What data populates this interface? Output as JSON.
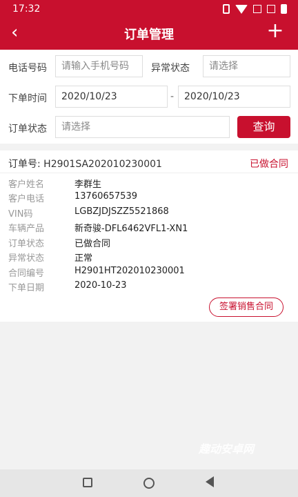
{
  "status_bar": {
    "time": "17:32"
  },
  "header": {
    "title": "订单管理",
    "back_icon": "‹",
    "add_icon": "+"
  },
  "filter": {
    "phone_label": "电话号码",
    "phone_placeholder": "请输入手机号码",
    "abnormal_label": "异常状态",
    "abnormal_placeholder": "请选择",
    "date_label": "下单时间",
    "date_from": "2020/10/23",
    "date_sep": "-",
    "date_to": "2020/10/23",
    "order_status_label": "订单状态",
    "order_status_placeholder": "请选择",
    "query_button": "查询"
  },
  "order": {
    "number_label": "订单号:",
    "number": "H2901SA202010230001",
    "status": "已做合同",
    "fields": [
      {
        "key": "客户姓名",
        "value": "李群生"
      },
      {
        "key": "客户电话",
        "value": "13760657539"
      },
      {
        "key": "VIN码",
        "value": "LGBZJDJSZZ5521868"
      },
      {
        "key": "车辆产品",
        "value": "新奇骏-DFL6462VFL1-XN1"
      },
      {
        "key": "订单状态",
        "value": "已做合同"
      },
      {
        "key": "异常状态",
        "value": "正常"
      },
      {
        "key": "合同编号",
        "value": "H2901HT202010230001"
      },
      {
        "key": "下单日期",
        "value": "2020-10-23"
      }
    ],
    "sign_button": "签署销售合同"
  },
  "watermark": "趣动安卓网",
  "colors": {
    "brand": "#c8102e"
  }
}
